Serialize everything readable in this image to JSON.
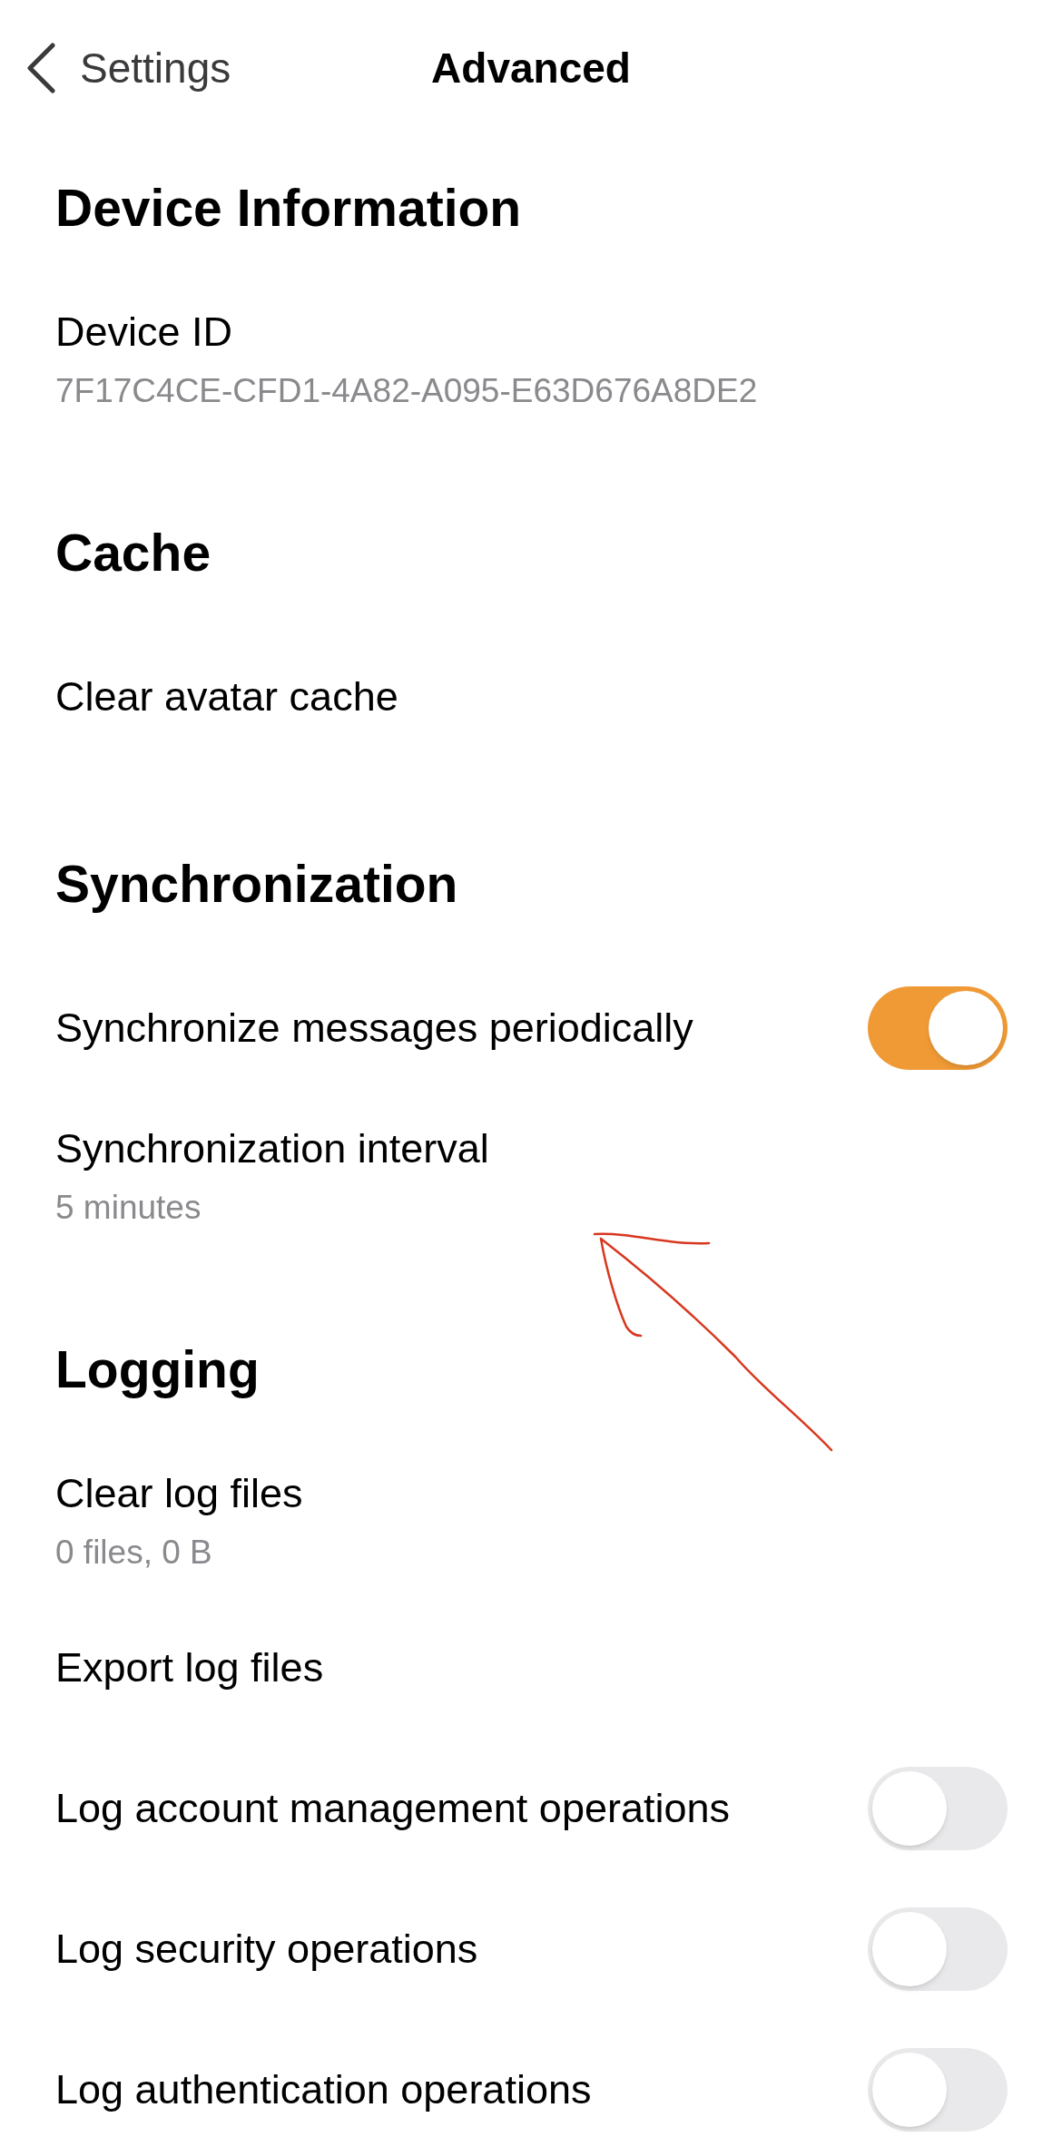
{
  "nav": {
    "back_label": "Settings",
    "title": "Advanced"
  },
  "sections": [
    {
      "title": "Device Information",
      "items": [
        {
          "kind": "info",
          "label": "Device ID",
          "detail": "7F17C4CE-CFD1-4A82-A095-E63D676A8DE2"
        }
      ]
    },
    {
      "title": "Cache",
      "items": [
        {
          "kind": "action",
          "label": "Clear avatar cache"
        }
      ]
    },
    {
      "title": "Synchronization",
      "items": [
        {
          "kind": "toggle",
          "label": "Synchronize messages periodically",
          "on": true
        },
        {
          "kind": "info",
          "label": "Synchronization interval",
          "detail": "5 minutes"
        }
      ]
    },
    {
      "title": "Logging",
      "items": [
        {
          "kind": "info",
          "label": "Clear log files",
          "detail": "0 files, 0 B"
        },
        {
          "kind": "action",
          "label": "Export log files"
        },
        {
          "kind": "toggle",
          "label": "Log account management operations",
          "on": false
        },
        {
          "kind": "toggle",
          "label": "Log security operations",
          "on": false
        },
        {
          "kind": "toggle",
          "label": "Log authentication operations",
          "on": false
        }
      ]
    }
  ]
}
